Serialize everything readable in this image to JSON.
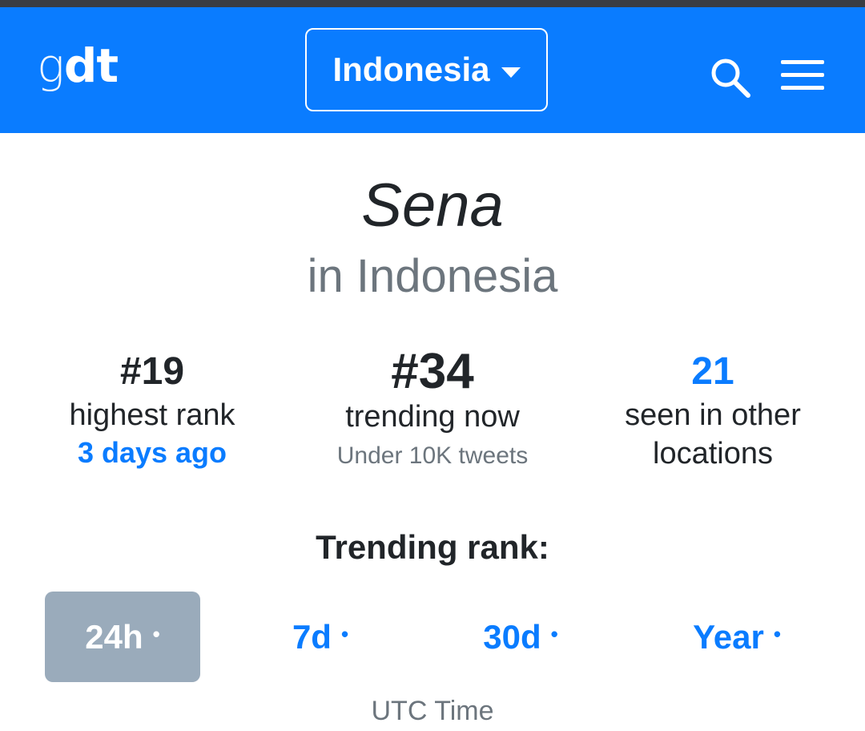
{
  "navbar": {
    "brand_part1": "g",
    "brand_part2": "dt",
    "country": "Indonesia",
    "search_icon": "search-icon",
    "menu_icon": "hamburger-menu-icon",
    "bg_color": "#0a7cff"
  },
  "trend": {
    "name": "Sena",
    "location": "in Indonesia"
  },
  "stats": {
    "highest": {
      "value": "#19",
      "label": "highest rank",
      "sub": "3 days ago"
    },
    "current": {
      "value": "#34",
      "label": "trending now",
      "sub": "Under 10K tweets"
    },
    "locations": {
      "value": "21",
      "label_line1": "seen in other",
      "label_line2": "locations"
    }
  },
  "rank_section": {
    "title": "Trending rank:",
    "tabs": [
      {
        "label": "24h",
        "active": true
      },
      {
        "label": "7d",
        "active": false
      },
      {
        "label": "30d",
        "active": false
      },
      {
        "label": "Year",
        "active": false
      }
    ],
    "dot": "•",
    "timezone": "UTC Time"
  },
  "colors": {
    "accent": "#0a7cff",
    "muted": "#6c757d",
    "active_tab_bg": "#9aabbb"
  }
}
